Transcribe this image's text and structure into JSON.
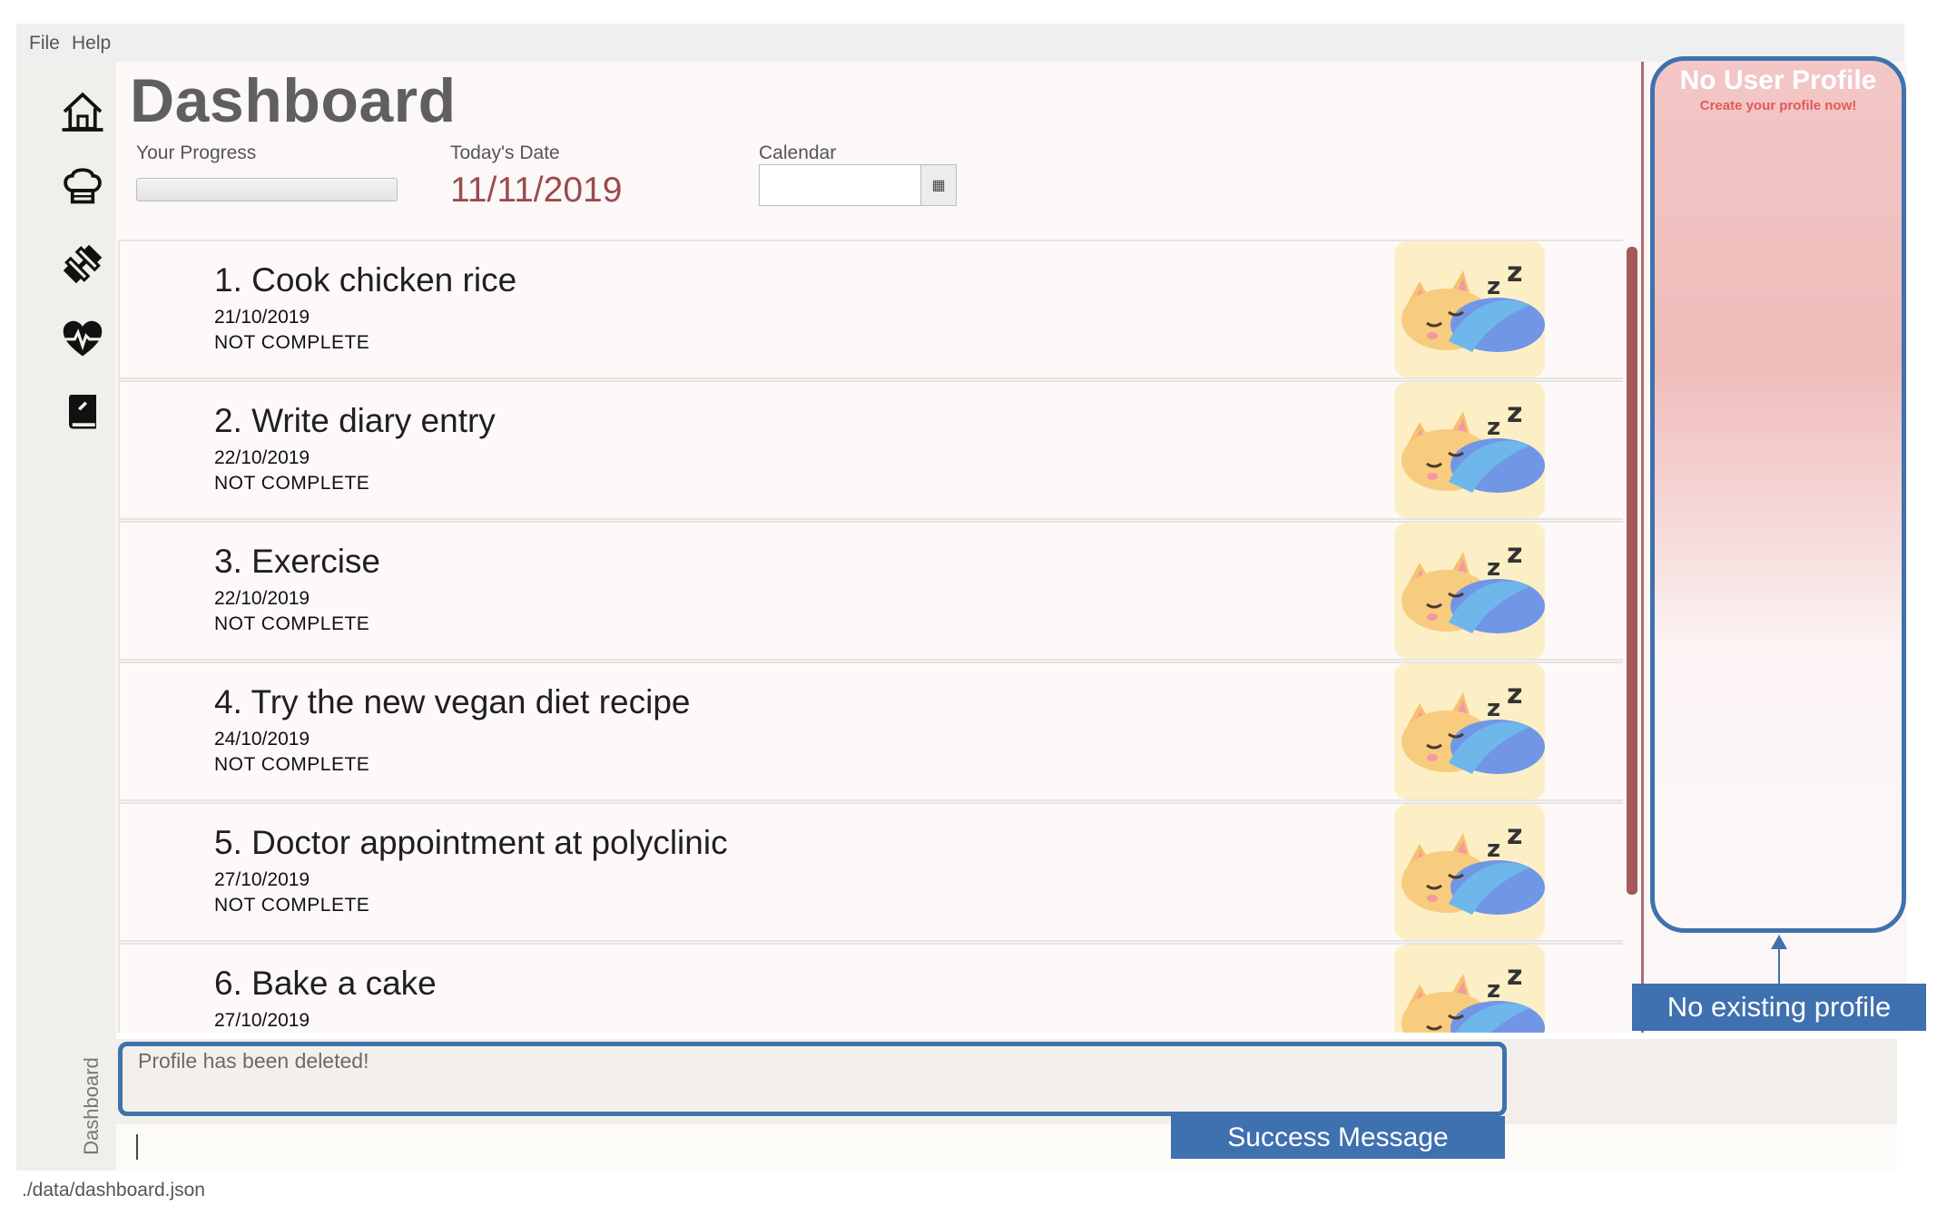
{
  "menu": {
    "file": "File",
    "help": "Help"
  },
  "nav": [
    {
      "icon": "home-icon"
    },
    {
      "icon": "chef-hat-icon"
    },
    {
      "icon": "dumbbell-icon"
    },
    {
      "icon": "heartbeat-icon"
    },
    {
      "icon": "diary-book-icon"
    }
  ],
  "header": {
    "title": "Dashboard",
    "progress_label": "Your Progress",
    "progress_value": 0,
    "date_label": "Today's Date",
    "date_value": "11/11/2019",
    "calendar_label": "Calendar",
    "calendar_value": ""
  },
  "tasks": [
    {
      "title": "1.  Cook chicken rice",
      "date": "21/10/2019",
      "status": "NOT COMPLETE",
      "image": "sleeping-cat-icon"
    },
    {
      "title": "2.  Write diary entry",
      "date": "22/10/2019",
      "status": "NOT COMPLETE",
      "image": "sleeping-cat-icon"
    },
    {
      "title": "3.  Exercise",
      "date": "22/10/2019",
      "status": "NOT COMPLETE",
      "image": "sleeping-cat-icon"
    },
    {
      "title": "4.  Try the new vegan diet recipe",
      "date": "24/10/2019",
      "status": "NOT COMPLETE",
      "image": "sleeping-cat-icon"
    },
    {
      "title": "5.  Doctor appointment at polyclinic",
      "date": "27/10/2019",
      "status": "NOT COMPLETE",
      "image": "sleeping-cat-icon"
    },
    {
      "title": "6.  Bake a cake",
      "date": "27/10/2019",
      "status": "",
      "image": "sleeping-cat-icon"
    }
  ],
  "profile": {
    "title": "No User Profile",
    "subtitle": "Create your profile now!",
    "callout": "No existing profile"
  },
  "result": {
    "message": "Profile has been deleted!",
    "callout": "Success Message"
  },
  "side_tab": "Dashboard",
  "command": {
    "value": ""
  },
  "status_bar": {
    "path": "./data/dashboard.json"
  },
  "colors": {
    "accent_blue": "#3f70b0",
    "date_red": "#9a4b4d",
    "scroll_thumb": "#a5595a",
    "profile_pink": "#f2c7c6",
    "cat_bg": "#fcefc6"
  }
}
